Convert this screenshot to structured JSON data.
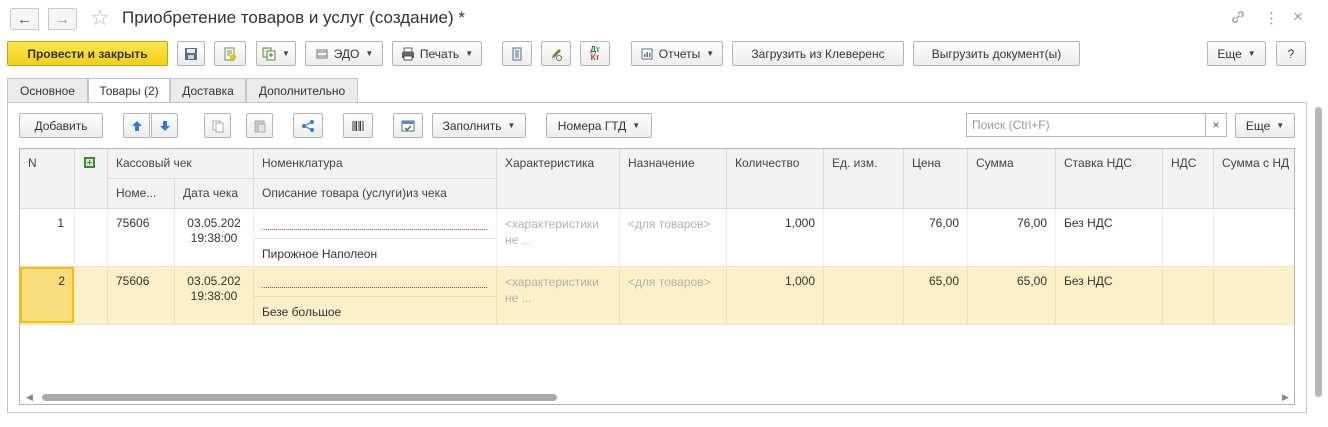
{
  "window": {
    "title": "Приобретение товаров и услуг (создание) *",
    "back_glyph": "←",
    "forward_glyph": "→",
    "favorite_glyph": "☆",
    "link_glyph": "🔗",
    "menu_glyph": "⋮",
    "close_glyph": "×"
  },
  "toolbar": {
    "post_close": "Провести и закрыть",
    "edo": "ЭДО",
    "print": "Печать",
    "dt_kt_top": "Дт",
    "dt_kt_bottom": "Кт",
    "reports": "Отчеты",
    "load_cleverence": "Загрузить из Клеверенс",
    "export_documents": "Выгрузить документ(ы)",
    "more": "Еще",
    "help": "?"
  },
  "tabs": [
    {
      "label": "Основное"
    },
    {
      "label": "Товары (2)"
    },
    {
      "label": "Доставка"
    },
    {
      "label": "Дополнительно"
    }
  ],
  "goods_toolbar": {
    "add": "Добавить",
    "fill": "Заполнить",
    "gtd_numbers": "Номера ГТД",
    "search_placeholder": "Поиск (Ctrl+F)",
    "search_clear": "×",
    "more": "Еще"
  },
  "table": {
    "headers": {
      "n": "N",
      "receipt": "Кассовый чек",
      "receipt_number": "Номе...",
      "receipt_date": "Дата чека",
      "nomenclature": "Номенклатура",
      "description": "Описание товара (услуги)из чека",
      "characteristic": "Характеристика",
      "purpose": "Назначение",
      "quantity": "Количество",
      "unit": "Ед. изм.",
      "price": "Цена",
      "sum": "Сумма",
      "vat_rate": "Ставка НДС",
      "vat": "НДС",
      "sum_with_vat": "Сумма с НД"
    },
    "rows": [
      {
        "n": "1",
        "receipt_number": "75606",
        "date": "03.05.202",
        "time": "19:38:00",
        "description": "Пирожное Наполеон",
        "characteristic": "<характеристики не ...",
        "purpose": "<для товаров>",
        "quantity": "1,000",
        "price": "76,00",
        "sum": "76,00",
        "vat_rate": "Без НДС"
      },
      {
        "n": "2",
        "receipt_number": "75606",
        "date": "03.05.202",
        "time": "19:38:00",
        "description": "Безе большое",
        "characteristic": "<характеристики не ...",
        "purpose": "<для товаров>",
        "quantity": "1,000",
        "price": "65,00",
        "sum": "65,00",
        "vat_rate": "Без НДС"
      }
    ]
  },
  "colors": {
    "primary_button": "#f4cf1a",
    "selected_row": "#fbf0c7",
    "current_cell": "#f9dc7c",
    "error_underline": "#d43c3c"
  }
}
